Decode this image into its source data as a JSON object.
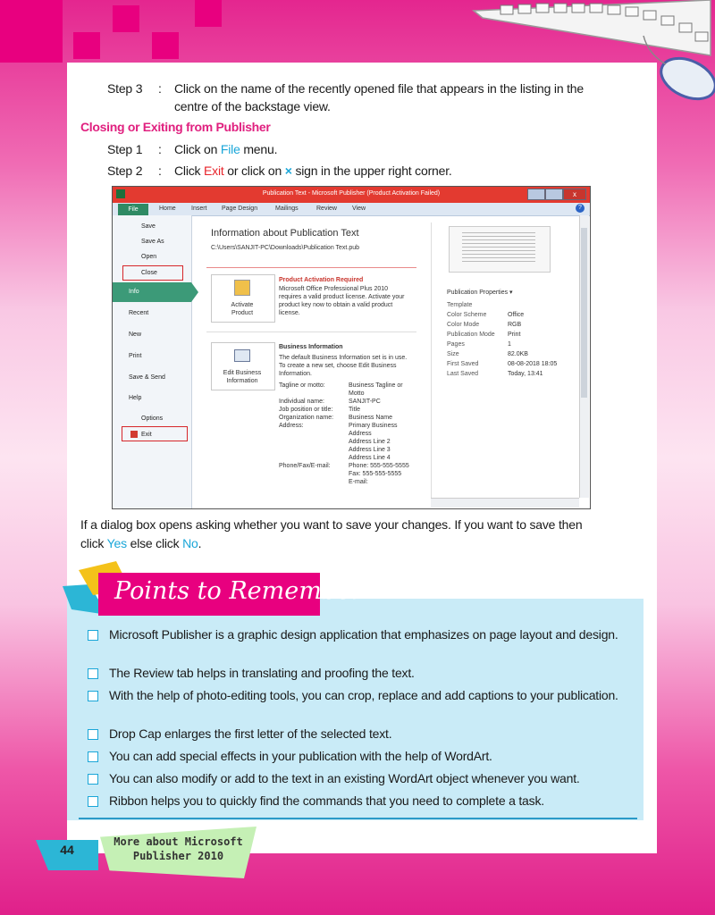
{
  "steps_top": {
    "step3_label": "Step 3",
    "step3_colon": ":",
    "step3_text_line1": "Click on the name of the recently opened file that appears in the listing in the",
    "step3_text_line2": "centre of the backstage view."
  },
  "section_heading": "Closing or Exiting from Publisher",
  "closing_steps": {
    "step1_label": "Step 1",
    "step1_colon": ":",
    "step1_pre": "Click on ",
    "step1_hl": "File",
    "step1_post": " menu.",
    "step2_label": "Step 2",
    "step2_colon": ":",
    "step2_pre": "Click ",
    "step2_hl": "Exit",
    "step2_mid": " or click on ",
    "step2_icon": "×",
    "step2_post": " sign in the upper right corner."
  },
  "screenshot": {
    "title": "Publication Text - Microsoft Publisher (Product Activation Failed)",
    "tabs": [
      "File",
      "Home",
      "Insert",
      "Page Design",
      "Mailings",
      "Review",
      "View"
    ],
    "side_items": [
      "Save",
      "Save As",
      "Open",
      "Close",
      "Info",
      "Recent",
      "New",
      "Print",
      "Save & Send",
      "Help",
      "Options",
      "Exit"
    ],
    "info_heading": "Information about Publication Text",
    "info_path": "C:\\Users\\SANJIT-PC\\Downloads\\Publication Text.pub",
    "activate_label1": "Activate",
    "activate_label2": "Product",
    "activation_title": "Product Activation Required",
    "activation_l1": "Microsoft Office Professional Plus 2010",
    "activation_l2": "requires a valid product license. Activate your",
    "activation_l3": "product key now to obtain a valid product",
    "activation_l4": "license.",
    "edit_label1": "Edit Business",
    "edit_label2": "Information",
    "bi_title": "Business Information",
    "bi_l1": "The default Business Information set is in use.",
    "bi_l2": "To create a new set, choose Edit Business",
    "bi_l3": "Information.",
    "bi_rows": [
      {
        "k": "Tagline or motto:",
        "v": "Business Tagline or"
      },
      {
        "k": "",
        "v": "Motto"
      },
      {
        "k": "Individual name:",
        "v": "SANJIT-PC"
      },
      {
        "k": "Job position or title:",
        "v": "Title"
      },
      {
        "k": "Organization name:",
        "v": "Business Name"
      },
      {
        "k": "Address:",
        "v": "Primary Business"
      },
      {
        "k": "",
        "v": "Address"
      },
      {
        "k": "",
        "v": "Address Line 2"
      },
      {
        "k": "",
        "v": "Address Line 3"
      },
      {
        "k": "",
        "v": "Address Line 4"
      },
      {
        "k": "Phone/Fax/E-mail:",
        "v": "Phone: 555-555-5555"
      },
      {
        "k": "",
        "v": "Fax: 555-555-5555"
      },
      {
        "k": "",
        "v": "E-mail:"
      }
    ],
    "props_title": "Publication Properties ▾",
    "props": [
      {
        "k": "Template",
        "v": ""
      },
      {
        "k": "Color Scheme",
        "v": "Office"
      },
      {
        "k": "Color Mode",
        "v": "RGB"
      },
      {
        "k": "Publication Mode",
        "v": "Print"
      },
      {
        "k": "Pages",
        "v": "1"
      },
      {
        "k": "Size",
        "v": "82.0KB"
      },
      {
        "k": "First Saved",
        "v": "08-08-2018 18:05"
      },
      {
        "k": "Last Saved",
        "v": "Today, 13:41"
      }
    ]
  },
  "dialog_text": {
    "line1": "If a dialog box opens asking whether you want to save your changes. If you want to save then",
    "l2_pre": "click ",
    "yes": "Yes",
    "l2_mid": " else click ",
    "no": "No",
    "l2_post": "."
  },
  "points_title": "Points to Remember",
  "points": [
    "Microsoft Publisher is a graphic design application that emphasizes on page layout  and design.",
    "The Review tab helps in translating and proofing the text.",
    "With the help of photo-editing tools, you can crop, replace and add captions to your publication.",
    "Drop Cap enlarges the first letter of the selected text.",
    "You can add special effects in your publication with the help of WordArt.",
    "You can also modify or add to the text in an existing WordArt object whenever you want.",
    "Ribbon helps you to quickly find the commands that you need to complete a task."
  ],
  "footer": {
    "page_number": "44",
    "line1": "More about Microsoft",
    "line2": "Publisher 2010"
  },
  "colors": {
    "magenta": "#e8007f",
    "cyan": "#1aa6d8",
    "red": "#e8232a",
    "box": "#c9ebf7"
  }
}
